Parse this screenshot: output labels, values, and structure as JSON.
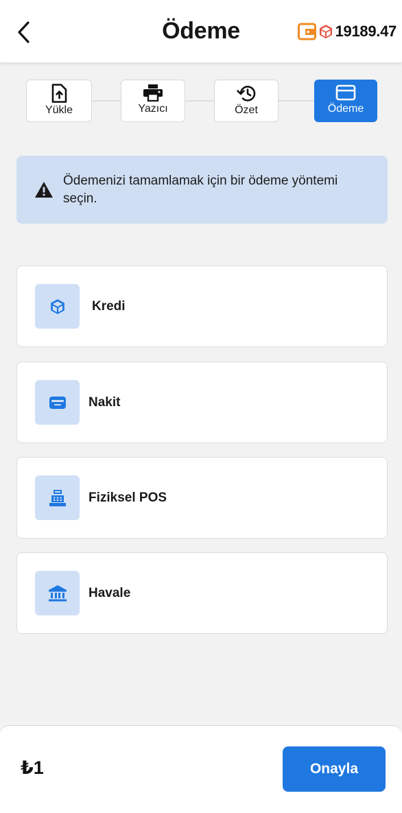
{
  "header": {
    "title": "Ödeme",
    "balance": "19189.47",
    "back_icon": "chevron-left-icon",
    "wallet_icon": "wallet-icon",
    "credit_icon": "credit-cube-icon",
    "wallet_color": "#f08a24"
  },
  "stepper": {
    "steps": [
      {
        "label": "Yükle",
        "icon": "upload-file-icon",
        "active": false
      },
      {
        "label": "Yazıcı",
        "icon": "printer-icon",
        "active": false
      },
      {
        "label": "Özet",
        "icon": "history-icon",
        "active": false
      },
      {
        "label": "Ödeme",
        "icon": "credit-card-icon",
        "active": true
      }
    ]
  },
  "alert": {
    "icon": "warning-icon",
    "text": "Ödemenizi tamamlamak için bir ödeme yöntemi seçin."
  },
  "methods": [
    {
      "label": "Kredi",
      "icon": "credit-cube-icon"
    },
    {
      "label": "Nakit",
      "icon": "cash-card-icon"
    },
    {
      "label": "Fiziksel POS",
      "icon": "cash-register-icon"
    },
    {
      "label": "Havale",
      "icon": "bank-icon"
    }
  ],
  "footer": {
    "amount": "₺1",
    "confirm_label": "Onayla"
  },
  "colors": {
    "accent": "#1f78e0",
    "alert_bg": "#cfdef2",
    "icon_bg": "#cfdff6"
  }
}
